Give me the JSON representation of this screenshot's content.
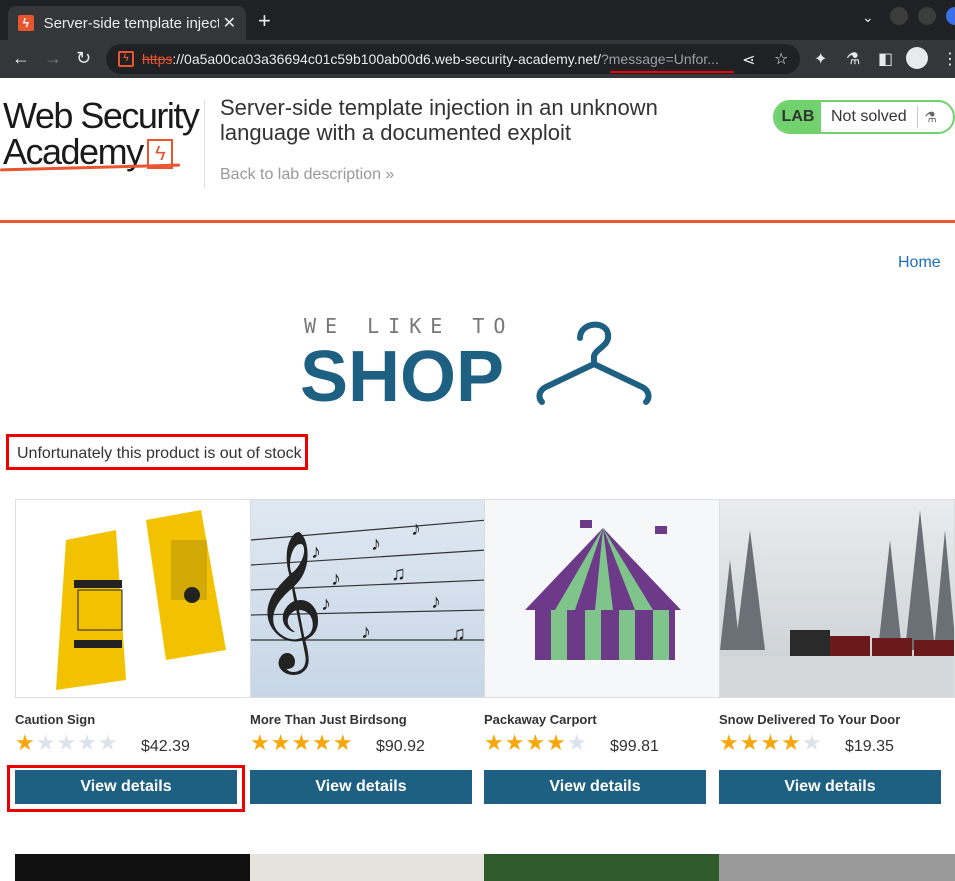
{
  "browser": {
    "tab_title": "Server-side template injection",
    "tab_close": "✕",
    "new_tab": "+",
    "url_scheme": "https",
    "url_host": "://0a5a00ca03a36694c01c59b100ab00d6.web-security-academy.net/",
    "url_query": "?message=Unfor..."
  },
  "lab": {
    "logo_line1": "Web Security",
    "logo_line2": "Academy",
    "title": "Server-side template injection in an unknown language with a documented exploit",
    "back_link": "Back to lab description »",
    "badge_label": "LAB",
    "status": "Not solved"
  },
  "shop": {
    "home_link": "Home",
    "brand_small": "WE LIKE TO",
    "brand_big": "SHOP",
    "message": "Unfortunately this product is out of stock",
    "products": [
      {
        "name": "Caution Sign",
        "rating": 1,
        "price": "$42.39",
        "button": "View details"
      },
      {
        "name": "More Than Just Birdsong",
        "rating": 5,
        "price": "$90.92",
        "button": "View details"
      },
      {
        "name": "Packaway Carport",
        "rating": 4,
        "price": "$99.81",
        "button": "View details"
      },
      {
        "name": "Snow Delivered To Your Door",
        "rating": 4,
        "price": "$19.35",
        "button": "View details"
      }
    ]
  },
  "colors": {
    "accent": "#e8552f",
    "button": "#1e6082",
    "highlight": "#e00000",
    "lab_green": "#70d16d"
  }
}
